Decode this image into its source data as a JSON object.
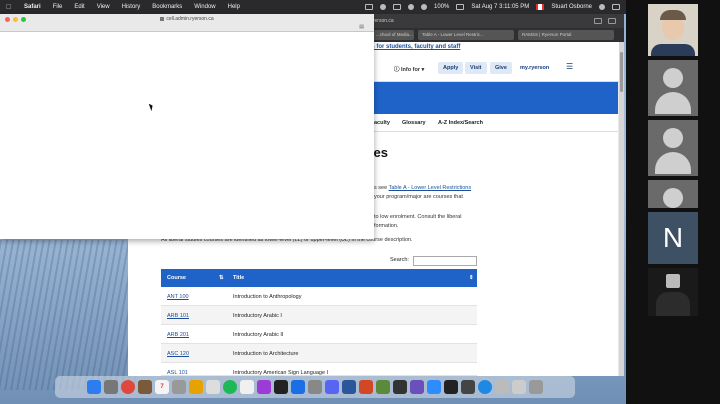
{
  "menubar": {
    "app": "Safari",
    "items": [
      "File",
      "Edit",
      "View",
      "History",
      "Bookmarks",
      "Window",
      "Help"
    ],
    "battery": "100%",
    "datetime": "Sat Aug 7  3:11:05 PM",
    "user": "Stuart Osborne"
  },
  "browser": {
    "url_fragment": "yerson.ca",
    "tabs": [
      "...chool of Media...",
      "Table A - Lower Level Restric...",
      "RAMSS | Ryerson Portal"
    ],
    "banner": "es for students, faculty and staff",
    "header": {
      "info_label": "Info for",
      "apply": "Apply",
      "visit": "Visit",
      "give": "Give",
      "myryerson": "my.ryerson"
    },
    "nav": [
      "aculty",
      "Glossary",
      "A-Z Index/Search"
    ],
    "heading": "dies",
    "para1_prefix": "s see ",
    "para1_link": "Table A - Lower Level Restrictions",
    "para1_line2": "your program/major are courses that",
    "para2_line1": "to low enrolment. Consult the liberal",
    "para2_line2": "formation.",
    "para3": "All liberal studies courses are identified as lower-level (LL) or upper-level (UL) in the course description.",
    "search_label": "Search:",
    "table": {
      "col_course": "Course",
      "col_title": "Title",
      "rows": [
        {
          "code": "ANT 100",
          "title": "Introduction to Anthropology"
        },
        {
          "code": "ARB 101",
          "title": "Introductory Arabic I"
        },
        {
          "code": "ARB 201",
          "title": "Introductory Arabic II"
        },
        {
          "code": "ASC 120",
          "title": "Introduction to Architecture"
        },
        {
          "code": "ASL 101",
          "title": "Introductory American Sign Language I"
        }
      ]
    }
  },
  "popup": {
    "url": "cell.admin.ryerson.ca"
  },
  "video_call": {
    "tile_letter": "N"
  },
  "colors": {
    "accent_blue": "#1f63c9",
    "link_blue": "#1b4f9c"
  }
}
